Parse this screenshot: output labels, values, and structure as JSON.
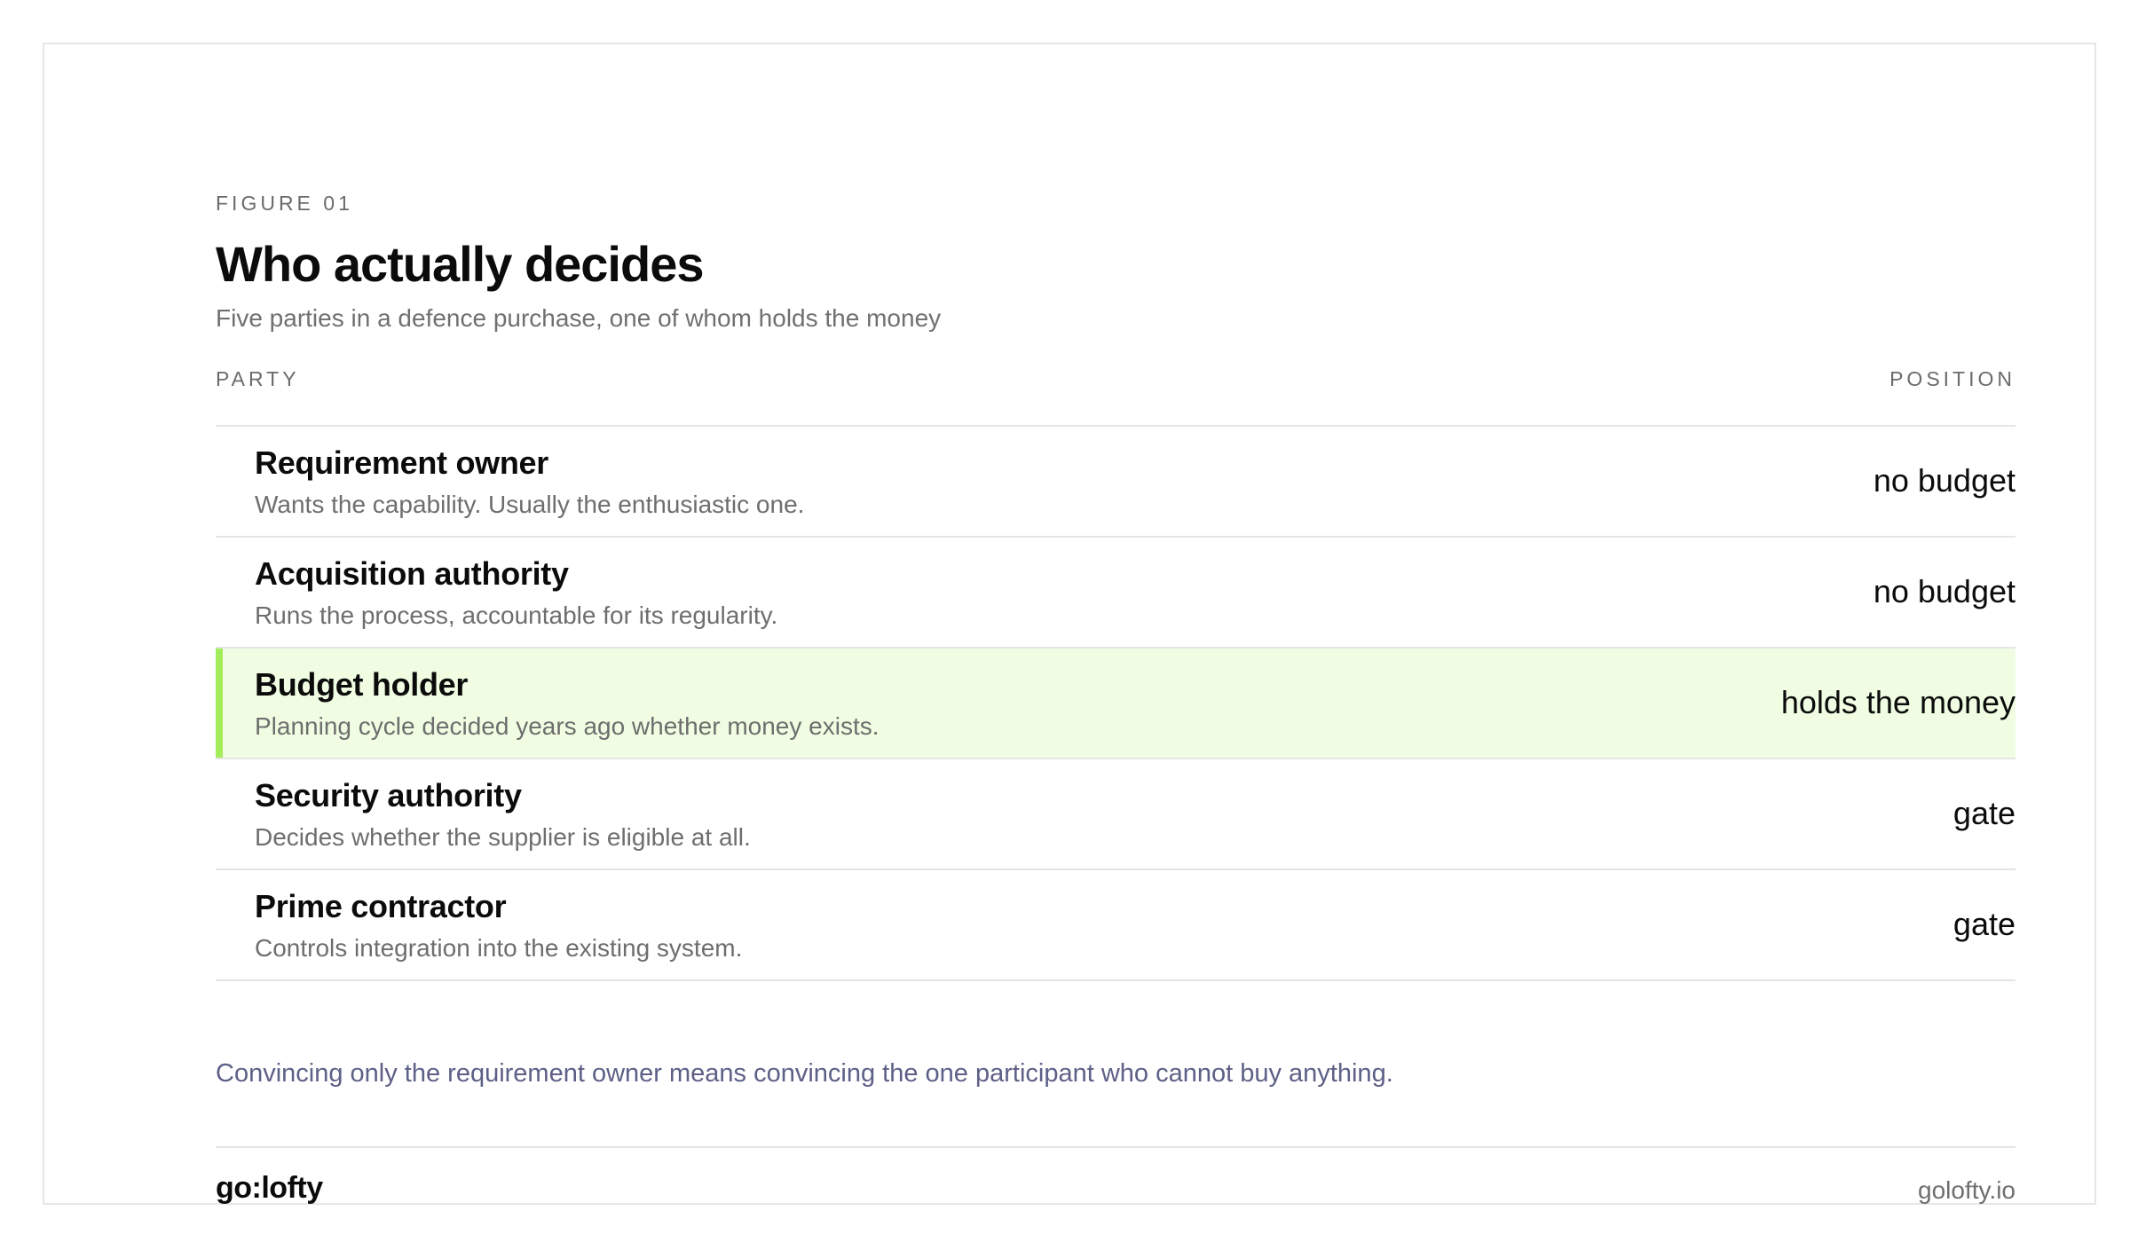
{
  "figure": {
    "kicker": "FIGURE 01",
    "title": "Who actually decides",
    "subtitle": "Five parties in a defence purchase, one of whom holds the money"
  },
  "columns": {
    "party": "PARTY",
    "position": "POSITION"
  },
  "rows": [
    {
      "name": "Requirement owner",
      "desc": "Wants the capability. Usually the enthusiastic one.",
      "position": "no budget",
      "highlighted": false
    },
    {
      "name": "Acquisition authority",
      "desc": "Runs the process, accountable for its regularity.",
      "position": "no budget",
      "highlighted": false
    },
    {
      "name": "Budget holder",
      "desc": "Planning cycle decided years ago whether money exists.",
      "position": "holds the money",
      "highlighted": true
    },
    {
      "name": "Security authority",
      "desc": "Decides whether the supplier is eligible at all.",
      "position": "gate",
      "highlighted": false
    },
    {
      "name": "Prime contractor",
      "desc": "Controls integration into the existing system.",
      "position": "gate",
      "highlighted": false
    }
  ],
  "note": "Convincing only the requirement owner means convincing the one participant who cannot buy anything.",
  "footer": {
    "brand": "go:lofty",
    "site": "golofty.io"
  },
  "colors": {
    "highlight_bg": "#f0fde2",
    "highlight_bar": "#a3ec5a",
    "note_text": "#5d6087"
  }
}
